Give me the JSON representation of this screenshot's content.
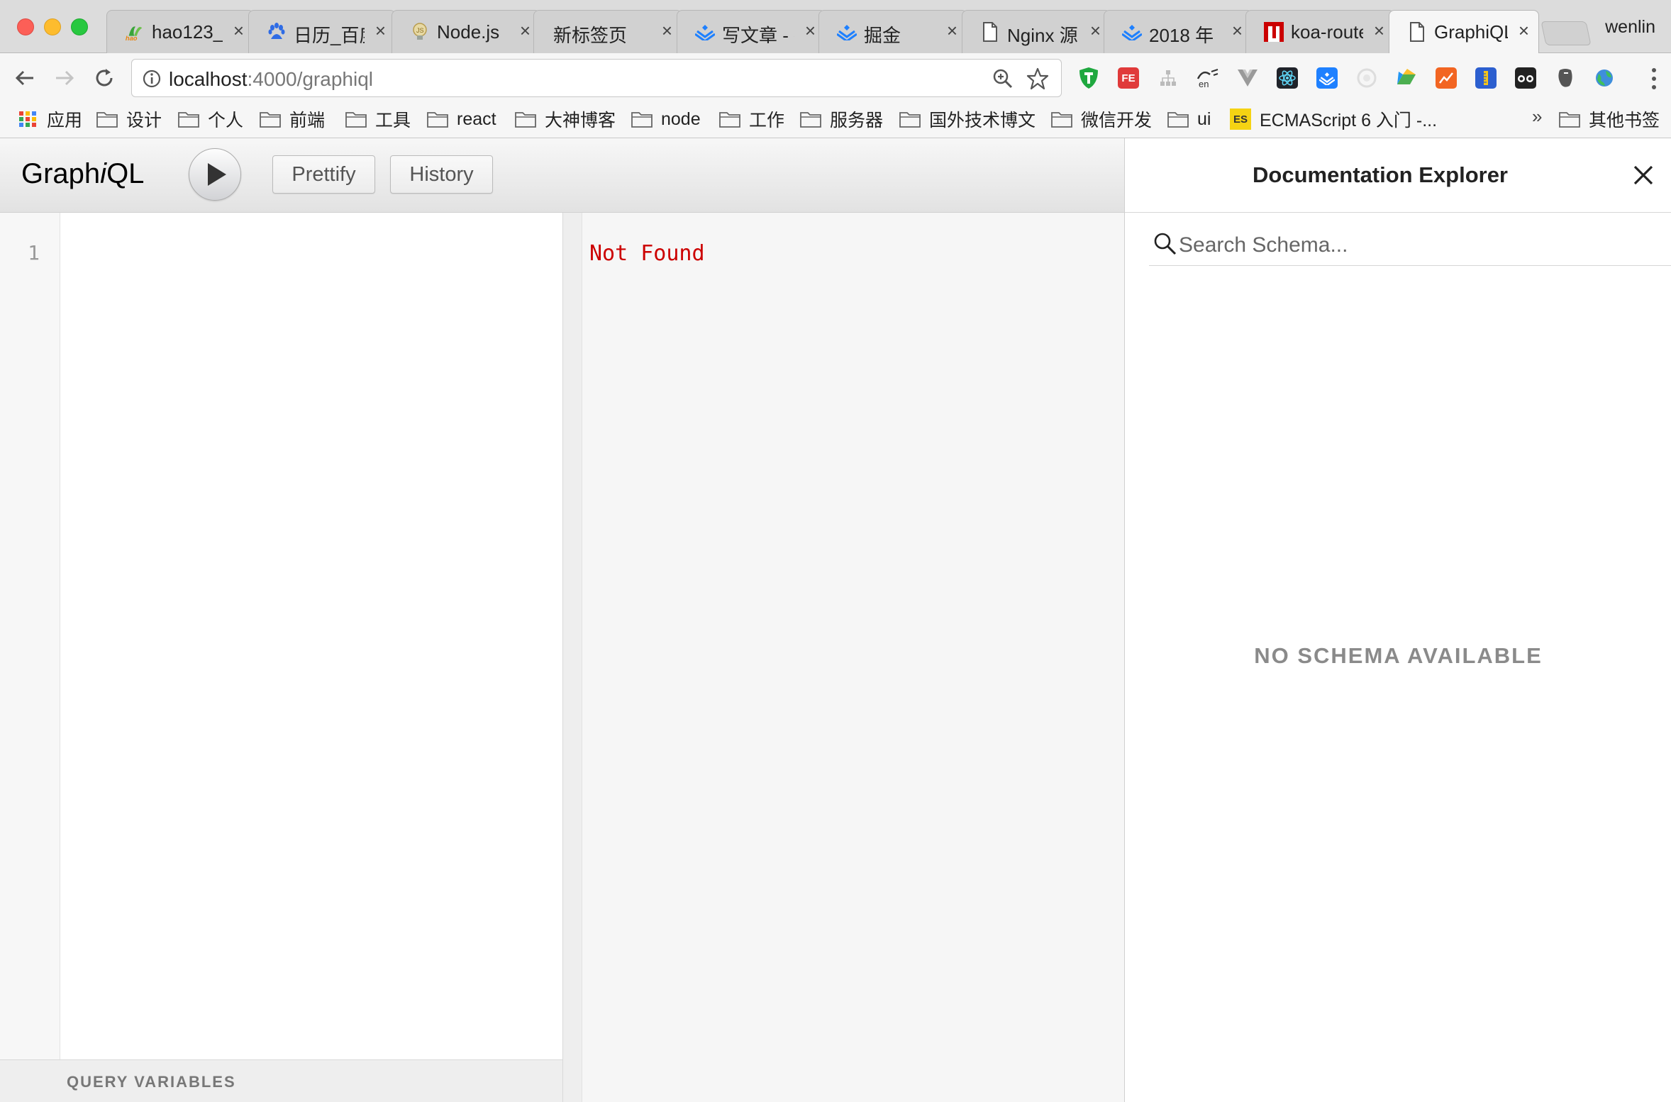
{
  "browser": {
    "profile_name": "wenlin",
    "tabs": [
      {
        "title": "hao123_",
        "icon": "hao123-icon"
      },
      {
        "title": "日历_百度",
        "icon": "baidu-paw-icon"
      },
      {
        "title": "Node.js",
        "icon": "nodejs-bulb-icon"
      },
      {
        "title": "新标签页",
        "icon": ""
      },
      {
        "title": "写文章 - 掘金",
        "icon": "juejin-icon"
      },
      {
        "title": "掘金",
        "icon": "juejin-icon"
      },
      {
        "title": "Nginx 源",
        "icon": "page-icon"
      },
      {
        "title": "2018 年",
        "icon": "juejin-icon"
      },
      {
        "title": "koa-router",
        "icon": "npm-icon"
      },
      {
        "title": "GraphiQL",
        "icon": "page-icon",
        "active": true
      }
    ],
    "url_host": "localhost",
    "url_path": ":4000/graphiql",
    "bookmarks": [
      {
        "label": "应用",
        "type": "apps"
      },
      {
        "label": "设计",
        "type": "folder"
      },
      {
        "label": "个人",
        "type": "folder"
      },
      {
        "label": "前端",
        "type": "folder"
      },
      {
        "label": "工具",
        "type": "folder"
      },
      {
        "label": "react",
        "type": "folder"
      },
      {
        "label": "大神博客",
        "type": "folder"
      },
      {
        "label": "node",
        "type": "folder"
      },
      {
        "label": "工作",
        "type": "folder"
      },
      {
        "label": "服务器",
        "type": "folder"
      },
      {
        "label": "国外技术博文",
        "type": "folder"
      },
      {
        "label": "微信开发",
        "type": "folder"
      },
      {
        "label": "ui",
        "type": "folder"
      },
      {
        "label": "ECMAScript 6 入门 -...",
        "type": "site",
        "badge": "ES"
      }
    ],
    "bookmarks_overflow": "»",
    "other_bookmarks": "其他书签",
    "extension_icons": [
      "adguard-icon",
      "fe-icon",
      "sitemap-icon",
      "translate-icon",
      "vue-icon",
      "react-devtools-icon",
      "juejin-ext-icon",
      "circle-ext-icon",
      "drive-ext-icon",
      "chart-ext-icon",
      "ruler-ext-icon",
      "glasses-ext-icon",
      "evernote-icon",
      "globe-ext-icon"
    ]
  },
  "graphiql": {
    "logo_pre": "Graph",
    "logo_i": "i",
    "logo_post": "QL",
    "prettify_label": "Prettify",
    "history_label": "History",
    "line_number": "1",
    "result_text": "Not Found",
    "query_variables_label": "QUERY VARIABLES",
    "docs_title": "Documentation Explorer",
    "search_placeholder": "Search Schema...",
    "no_schema_text": "NO SCHEMA AVAILABLE"
  },
  "colors": {
    "error_red": "#cc0000",
    "tab_active_bg": "#f6f6f6"
  }
}
